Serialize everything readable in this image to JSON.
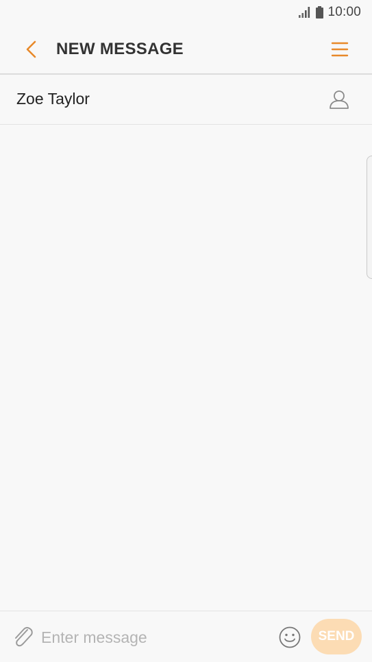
{
  "colors": {
    "accent": "#e8892a",
    "send_bg_disabled": "#fcdcb4",
    "background": "#f8f8f8",
    "text_primary": "#333333",
    "placeholder": "#b4b4b4"
  },
  "status_bar": {
    "time": "10:00",
    "icons": [
      "signal-icon",
      "battery-icon"
    ]
  },
  "app_bar": {
    "title": "NEW MESSAGE",
    "back_icon": "chevron-left-icon",
    "menu_icon": "menu-icon"
  },
  "recipient": {
    "name": "Zoe Taylor",
    "contact_icon": "contact-person-icon"
  },
  "composer": {
    "attach_icon": "paperclip-icon",
    "placeholder": "Enter message",
    "value": "",
    "emoji_icon": "emoji-icon",
    "send_label": "SEND"
  }
}
